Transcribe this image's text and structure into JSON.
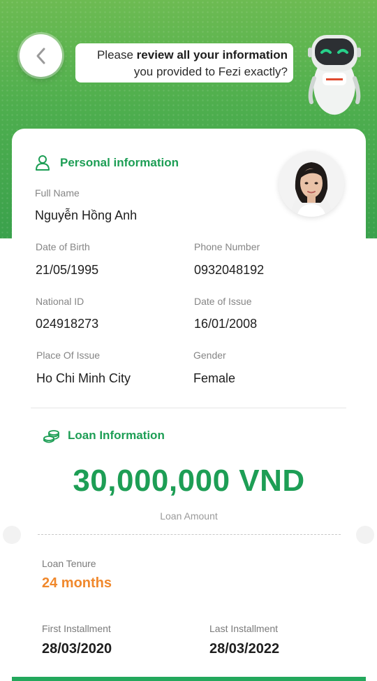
{
  "header": {
    "prompt_prefix": "Please ",
    "prompt_bold": "review all your information",
    "prompt_suffix": "you provided to Fezi exactly?"
  },
  "personal": {
    "title": "Personal information",
    "full_name_label": "Full Name",
    "full_name": "Nguyễn Hồng Anh",
    "dob_label": "Date of Birth",
    "dob": "21/05/1995",
    "phone_label": "Phone Number",
    "phone": "0932048192",
    "national_id_label": "National ID",
    "national_id": "024918273",
    "issue_date_label": "Date of Issue",
    "issue_date": "16/01/2008",
    "place_label": "Place Of Issue",
    "place": "Ho Chi Minh City",
    "gender_label": "Gender",
    "gender": "Female"
  },
  "loan": {
    "title": "Loan Information",
    "amount": "30,000,000 VND",
    "amount_label": "Loan Amount",
    "tenure_label": "Loan Tenure",
    "tenure": "24 months",
    "first_label": "First Installment",
    "first": "28/03/2020",
    "last_label": "Last Installment",
    "last": "28/03/2022"
  },
  "colors": {
    "brand_green": "#1d9e55",
    "accent_orange": "#f0882c"
  }
}
